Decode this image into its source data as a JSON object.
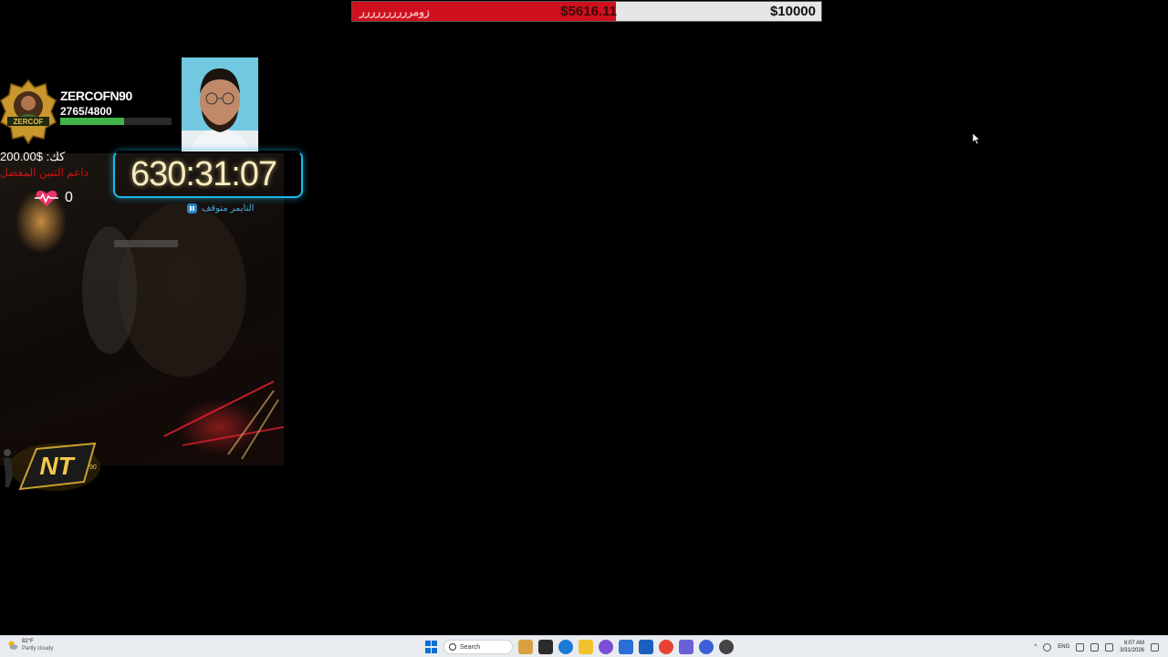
{
  "goal": {
    "name": "زومرررررررررر",
    "current": "$5616.11",
    "target": "$10000",
    "progress_fraction": 0.5616
  },
  "profile": {
    "name": "ZERCOFN90",
    "xp": "2765/4800",
    "xp_fraction": 0.576,
    "badge_text": "ZERCOF"
  },
  "donation": {
    "label": "200.00$ :كك",
    "sublabel": "داعم التنين المفضل",
    "heart_count": "0"
  },
  "timer": {
    "value": "630:31:07",
    "status": "التايمر متوقف"
  },
  "logo": {
    "text": "NT",
    "sub": "90"
  },
  "taskbar": {
    "weather_temp": "82°F",
    "weather_cond": "Partly cloudy",
    "search_placeholder": "Search",
    "lang": "ENG",
    "time": "6:07 AM",
    "date": "3/31/2026"
  },
  "colors": {
    "goal_fill": "#d0101e",
    "xp_fill": "#3fb54a",
    "timer_border": "#1ab8e8",
    "taskbar_bg": "#e8ebef"
  }
}
